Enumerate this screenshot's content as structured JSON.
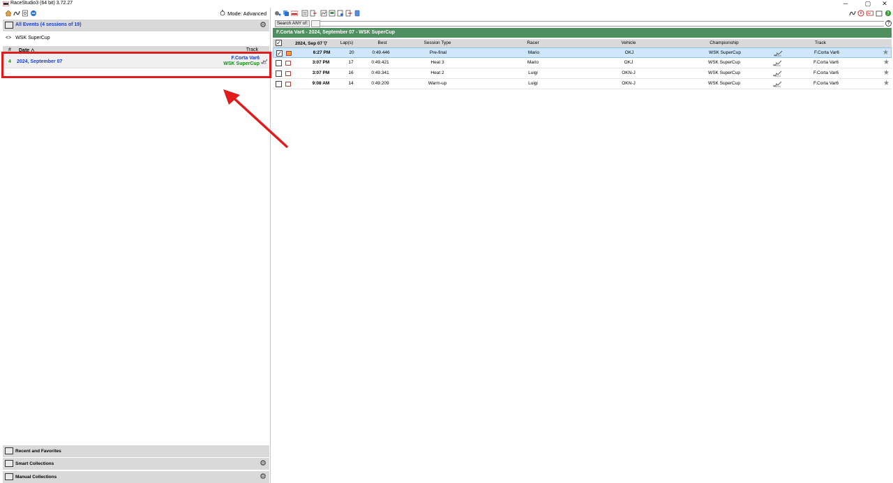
{
  "window": {
    "title": "RaceStudio3 (64 bit) 3.72.27",
    "controls": [
      "─",
      "▢",
      "✕"
    ]
  },
  "left": {
    "mode_label": "Mode: Advanced",
    "events_label": "All Events (4 sessions of 19)",
    "breadcrumb_arrow": "<>",
    "breadcrumb": "WSK SuperCup",
    "tree_headers": {
      "num": "#",
      "date": "Date △",
      "track": "Track"
    },
    "tree_row": {
      "count": "4",
      "date": "2024, September 07",
      "track": "F.Corta Var6",
      "championship": "WSK SuperCup"
    },
    "collections": [
      {
        "label": "Recent and Favorites"
      },
      {
        "label": "Smart Collections"
      },
      {
        "label": "Manual Collections"
      }
    ]
  },
  "right": {
    "search_label": "Search ANY of:",
    "search_value": "",
    "help": "?",
    "banner": "F.Corta Var6 - 2024, September 07 - WSK SuperCup",
    "columns": {
      "date": "2024, Sep 07 ▽",
      "laps": "Lap(s)",
      "best": "Best",
      "session_type": "Session Type",
      "racer": "Racer",
      "vehicle": "Vehicle",
      "championship": "Championship",
      "track": "Track"
    },
    "rows": [
      {
        "time": "6:27 PM",
        "laps": "20",
        "best": "0:49.446",
        "session_type": "Pre-final",
        "racer": "Mario",
        "vehicle": "OKJ",
        "championship": "WSK SuperCup",
        "track": "F.Corta Var6",
        "checked": "✓"
      },
      {
        "time": "3:07 PM",
        "laps": "17",
        "best": "0:49.421",
        "session_type": "Heat 3",
        "racer": "Mario",
        "vehicle": "OKJ",
        "championship": "WSK SuperCup",
        "track": "F.Corta Var6",
        "checked": ""
      },
      {
        "time": "3:07 PM",
        "laps": "16",
        "best": "0:49.341",
        "session_type": "Heat 2",
        "racer": "Luigi",
        "vehicle": "OKN-J",
        "championship": "WSK SuperCup",
        "track": "F.Corta Var6",
        "checked": ""
      },
      {
        "time": "9:08 AM",
        "laps": "14",
        "best": "0:49.209",
        "session_type": "Warm-up",
        "racer": "Luigi",
        "vehicle": "OKN-J",
        "championship": "WSK SuperCup",
        "track": "F.Corta Var6",
        "checked": ""
      }
    ],
    "header_check": "✓",
    "star_glyph": "★"
  },
  "colors": {
    "banner": "#4f8f5f",
    "highlight": "#e01b1b",
    "link_blue": "#1a3fd0",
    "link_green": "#1a8a1a",
    "selection": "#cfe6fb"
  }
}
